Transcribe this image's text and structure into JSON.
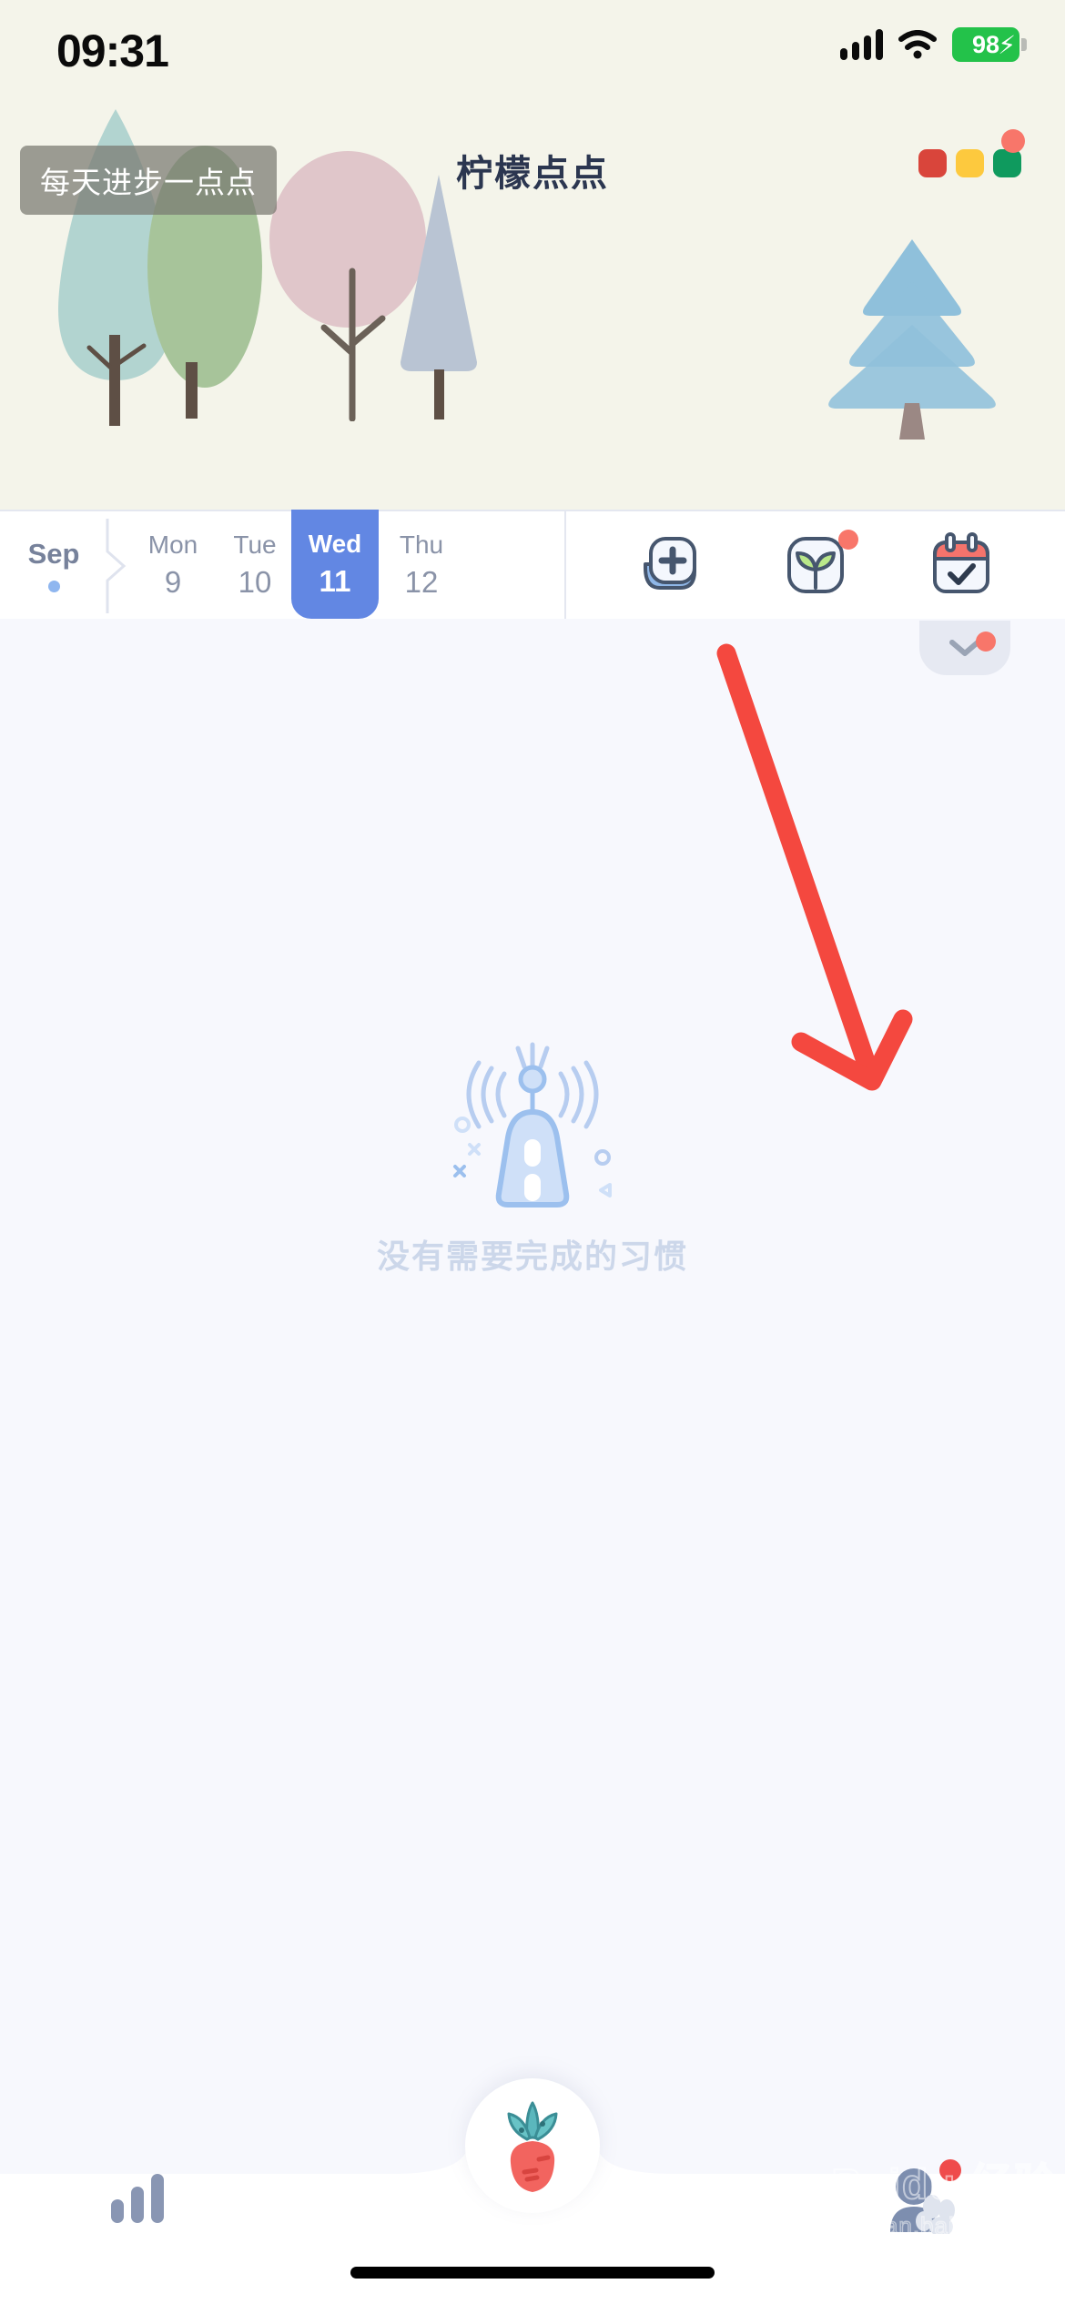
{
  "status_bar": {
    "time": "09:31",
    "signal_icon": "cellular-signal-icon",
    "wifi_icon": "wifi-icon",
    "battery_level": "98",
    "battery_charging": true,
    "battery_color": "#23c24a"
  },
  "header": {
    "title": "柠檬点点",
    "tooltip": "每天进步一点点",
    "window_dots": [
      {
        "name": "red-dot",
        "color": "#d9453b"
      },
      {
        "name": "yellow-dot",
        "color": "#fdc93e"
      },
      {
        "name": "green-dot",
        "color": "#0f9a5e"
      }
    ],
    "badge_color": "#f8766a",
    "scene_background": "#f4f4ea",
    "trees": [
      {
        "name": "teal-poplar-tree",
        "color": "#b2d4d0"
      },
      {
        "name": "green-oval-tree",
        "color": "#a7c49a"
      },
      {
        "name": "pink-round-tree",
        "color": "#e0c6ca"
      },
      {
        "name": "gray-cone-tree",
        "color": "#b9c4d3"
      },
      {
        "name": "blue-pine-tree",
        "color": "#8fc0db"
      }
    ]
  },
  "date_strip": {
    "month_label": "Sep",
    "month_dot_color": "#8fb6ef",
    "selected_color": "#6287e3",
    "days": [
      {
        "dow": "Mon",
        "num": "9",
        "selected": false
      },
      {
        "dow": "Tue",
        "num": "10",
        "selected": false
      },
      {
        "dow": "Wed",
        "num": "11",
        "selected": true
      },
      {
        "dow": "Thu",
        "num": "12",
        "selected": false
      }
    ],
    "actions": [
      {
        "name": "add-habit-icon",
        "label": "add",
        "badge": false
      },
      {
        "name": "plant-sprout-icon",
        "label": "plant",
        "badge": true
      },
      {
        "name": "calendar-check-icon",
        "label": "calendar",
        "badge": false
      }
    ]
  },
  "main": {
    "background": "#f7f8fd",
    "collapse_icon": "chevron-down-icon",
    "collapse_badge": true,
    "empty_state": {
      "icon": "signal-tower-icon",
      "text": "没有需要完成的习惯",
      "text_color": "#ccd7ea"
    },
    "annotation": {
      "name": "red-arrow-annotation",
      "color": "#f4483f",
      "points_to": "profile-tab"
    }
  },
  "tab_bar": {
    "background": "#ffffff",
    "items": [
      {
        "name": "stats-tab",
        "icon": "bar-chart-icon",
        "badge": false
      },
      {
        "name": "profile-tab",
        "icon": "person-icon",
        "badge": true
      }
    ],
    "fab": {
      "name": "carrot-fab",
      "icon": "carrot-icon",
      "leaf_color": "#5bb7bd",
      "body_color": "#f2645f"
    },
    "badge_color": "#ef4b4b"
  },
  "watermark": {
    "main": "Baidu 经验",
    "sub": "jingyan.baidu.com"
  }
}
